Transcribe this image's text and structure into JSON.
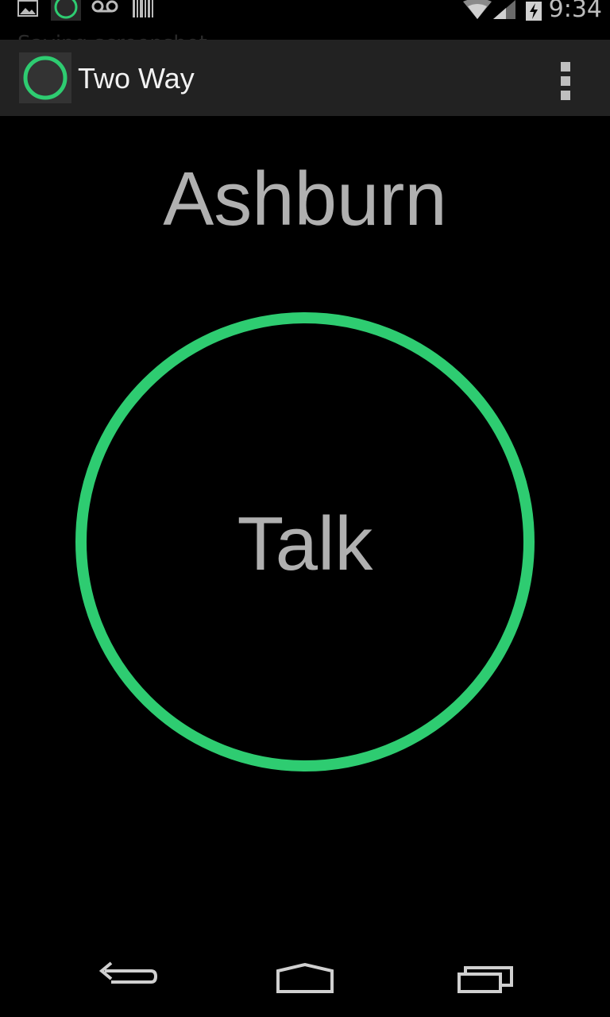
{
  "status_bar": {
    "time": "9:34",
    "peek_text": "Saving screenshot..."
  },
  "action_bar": {
    "title": "Two Way",
    "accent_color": "#2ecc71"
  },
  "main": {
    "location": "Ashburn",
    "talk_label": "Talk",
    "ring_color": "#2ecc71"
  },
  "icons": {
    "status_left": [
      "image-icon",
      "app-ring-icon",
      "voicemail-icon",
      "barcode-icon"
    ],
    "status_right": [
      "wifi-icon",
      "cell-signal-icon",
      "battery-charging-icon"
    ],
    "nav": [
      "back-icon",
      "home-icon",
      "recent-apps-icon"
    ],
    "menu": "overflow-menu-icon"
  }
}
